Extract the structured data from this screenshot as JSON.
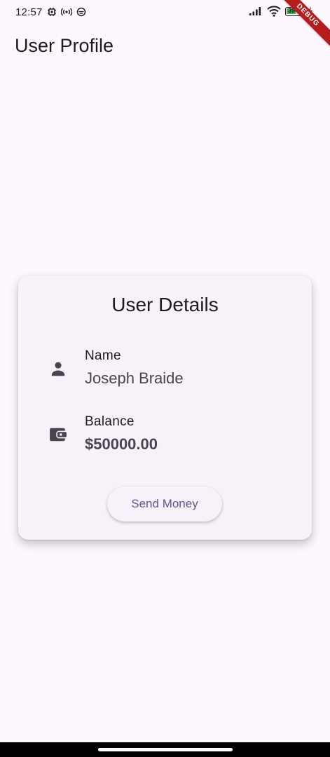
{
  "status_bar": {
    "time": "12:57",
    "battery_level": "39",
    "icons": [
      "cpu-chip-icon",
      "broadcast-icon",
      "shield-icon",
      "signal-icon",
      "wifi-icon",
      "battery-icon",
      "charging-icon"
    ]
  },
  "debug_banner": "DEBUG",
  "app_bar": {
    "title": "User Profile"
  },
  "card": {
    "title": "User Details",
    "name_label": "Name",
    "name_value": "Joseph Braide",
    "balance_label": "Balance",
    "balance_value": "$50000.00",
    "send_button_label": "Send Money"
  },
  "colors": {
    "background": "#FEF7FF",
    "card": "#F7F2FA",
    "primary": "#65558F",
    "on_surface": "#1D1B20",
    "on_surface_variant": "#49454F",
    "battery_fill": "#4CAF50",
    "debug_ribbon": "#B71C1C"
  }
}
